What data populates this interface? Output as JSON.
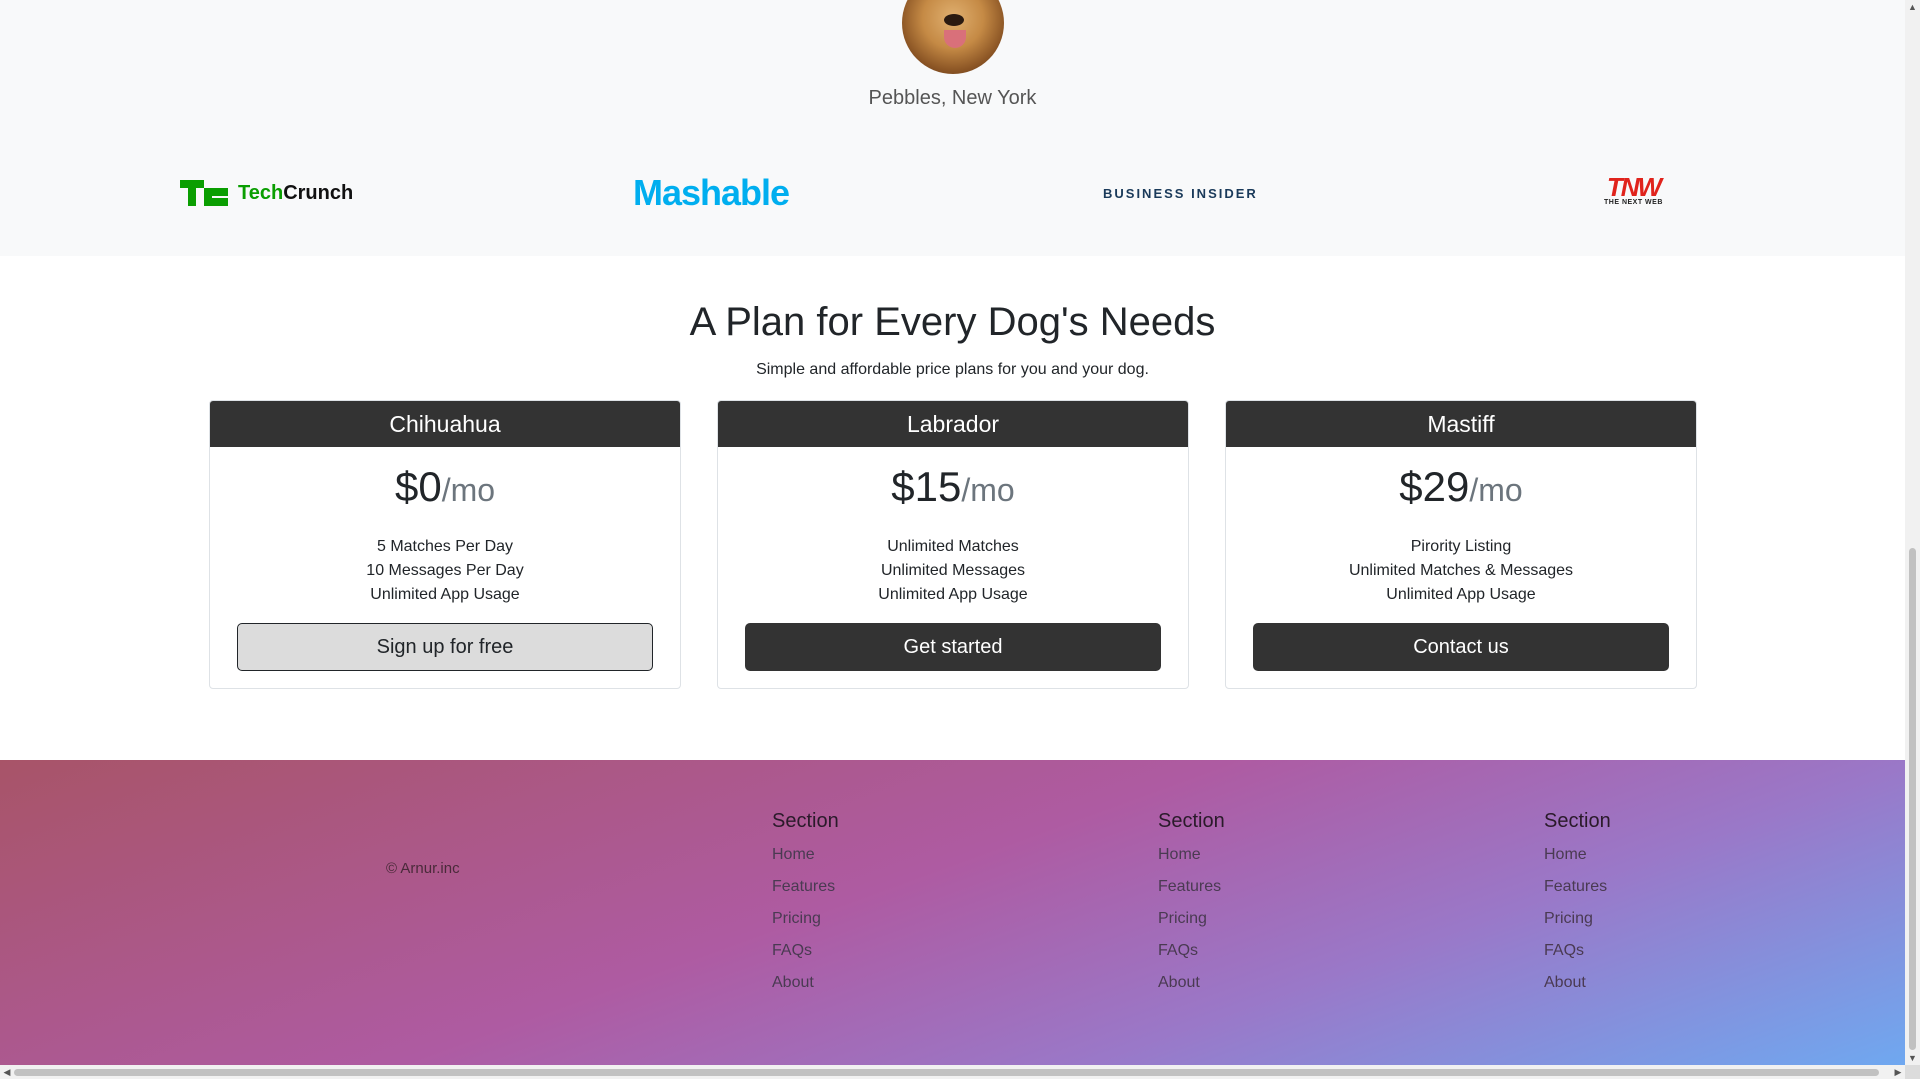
{
  "testimonial": {
    "name": "Pebbles, New York"
  },
  "press": {
    "logos": [
      {
        "text_left": "Tech",
        "text_right": "Crunch",
        "icon": "techcrunch-logo"
      },
      {
        "text": "Mashable",
        "icon": "mashable-logo"
      },
      {
        "text": "BUSINESS INSIDER",
        "icon": "business-insider-logo"
      },
      {
        "text": "TNW",
        "subtext": "THE NEXT WEB",
        "icon": "tnw-logo"
      }
    ]
  },
  "pricing": {
    "title": "A Plan for Every Dog's Needs",
    "subtitle": "Simple and affordable price plans for you and your dog.",
    "plans": [
      {
        "name": "Chihuahua",
        "price": "$0",
        "period": "/mo",
        "features": [
          "5 Matches Per Day",
          "10 Messages Per Day",
          "Unlimited App Usage"
        ],
        "button": "Sign up for free"
      },
      {
        "name": "Labrador",
        "price": "$15",
        "period": "/mo",
        "features": [
          "Unlimited Matches",
          "Unlimited Messages",
          "Unlimited App Usage"
        ],
        "button": "Get started"
      },
      {
        "name": "Mastiff",
        "price": "$29",
        "period": "/mo",
        "features": [
          "Pirority Listing",
          "Unlimited Matches & Messages",
          "Unlimited App Usage"
        ],
        "button": "Contact us"
      }
    ]
  },
  "footer": {
    "copyright": "© Arnur.inc",
    "columns": [
      {
        "heading": "Section",
        "links": [
          "Home",
          "Features",
          "Pricing",
          "FAQs",
          "About"
        ]
      },
      {
        "heading": "Section",
        "links": [
          "Home",
          "Features",
          "Pricing",
          "FAQs",
          "About"
        ]
      },
      {
        "heading": "Section",
        "links": [
          "Home",
          "Features",
          "Pricing",
          "FAQs",
          "About"
        ]
      }
    ],
    "gradient": [
      "#a85468",
      "#ae5ba2",
      "#9a78c8",
      "#6fa8f0"
    ]
  },
  "colors": {
    "dark": "#333333",
    "techcrunch_green": "#0a9e01",
    "mashable_blue": "#00aeef",
    "tnw_red": "#e0231c"
  }
}
